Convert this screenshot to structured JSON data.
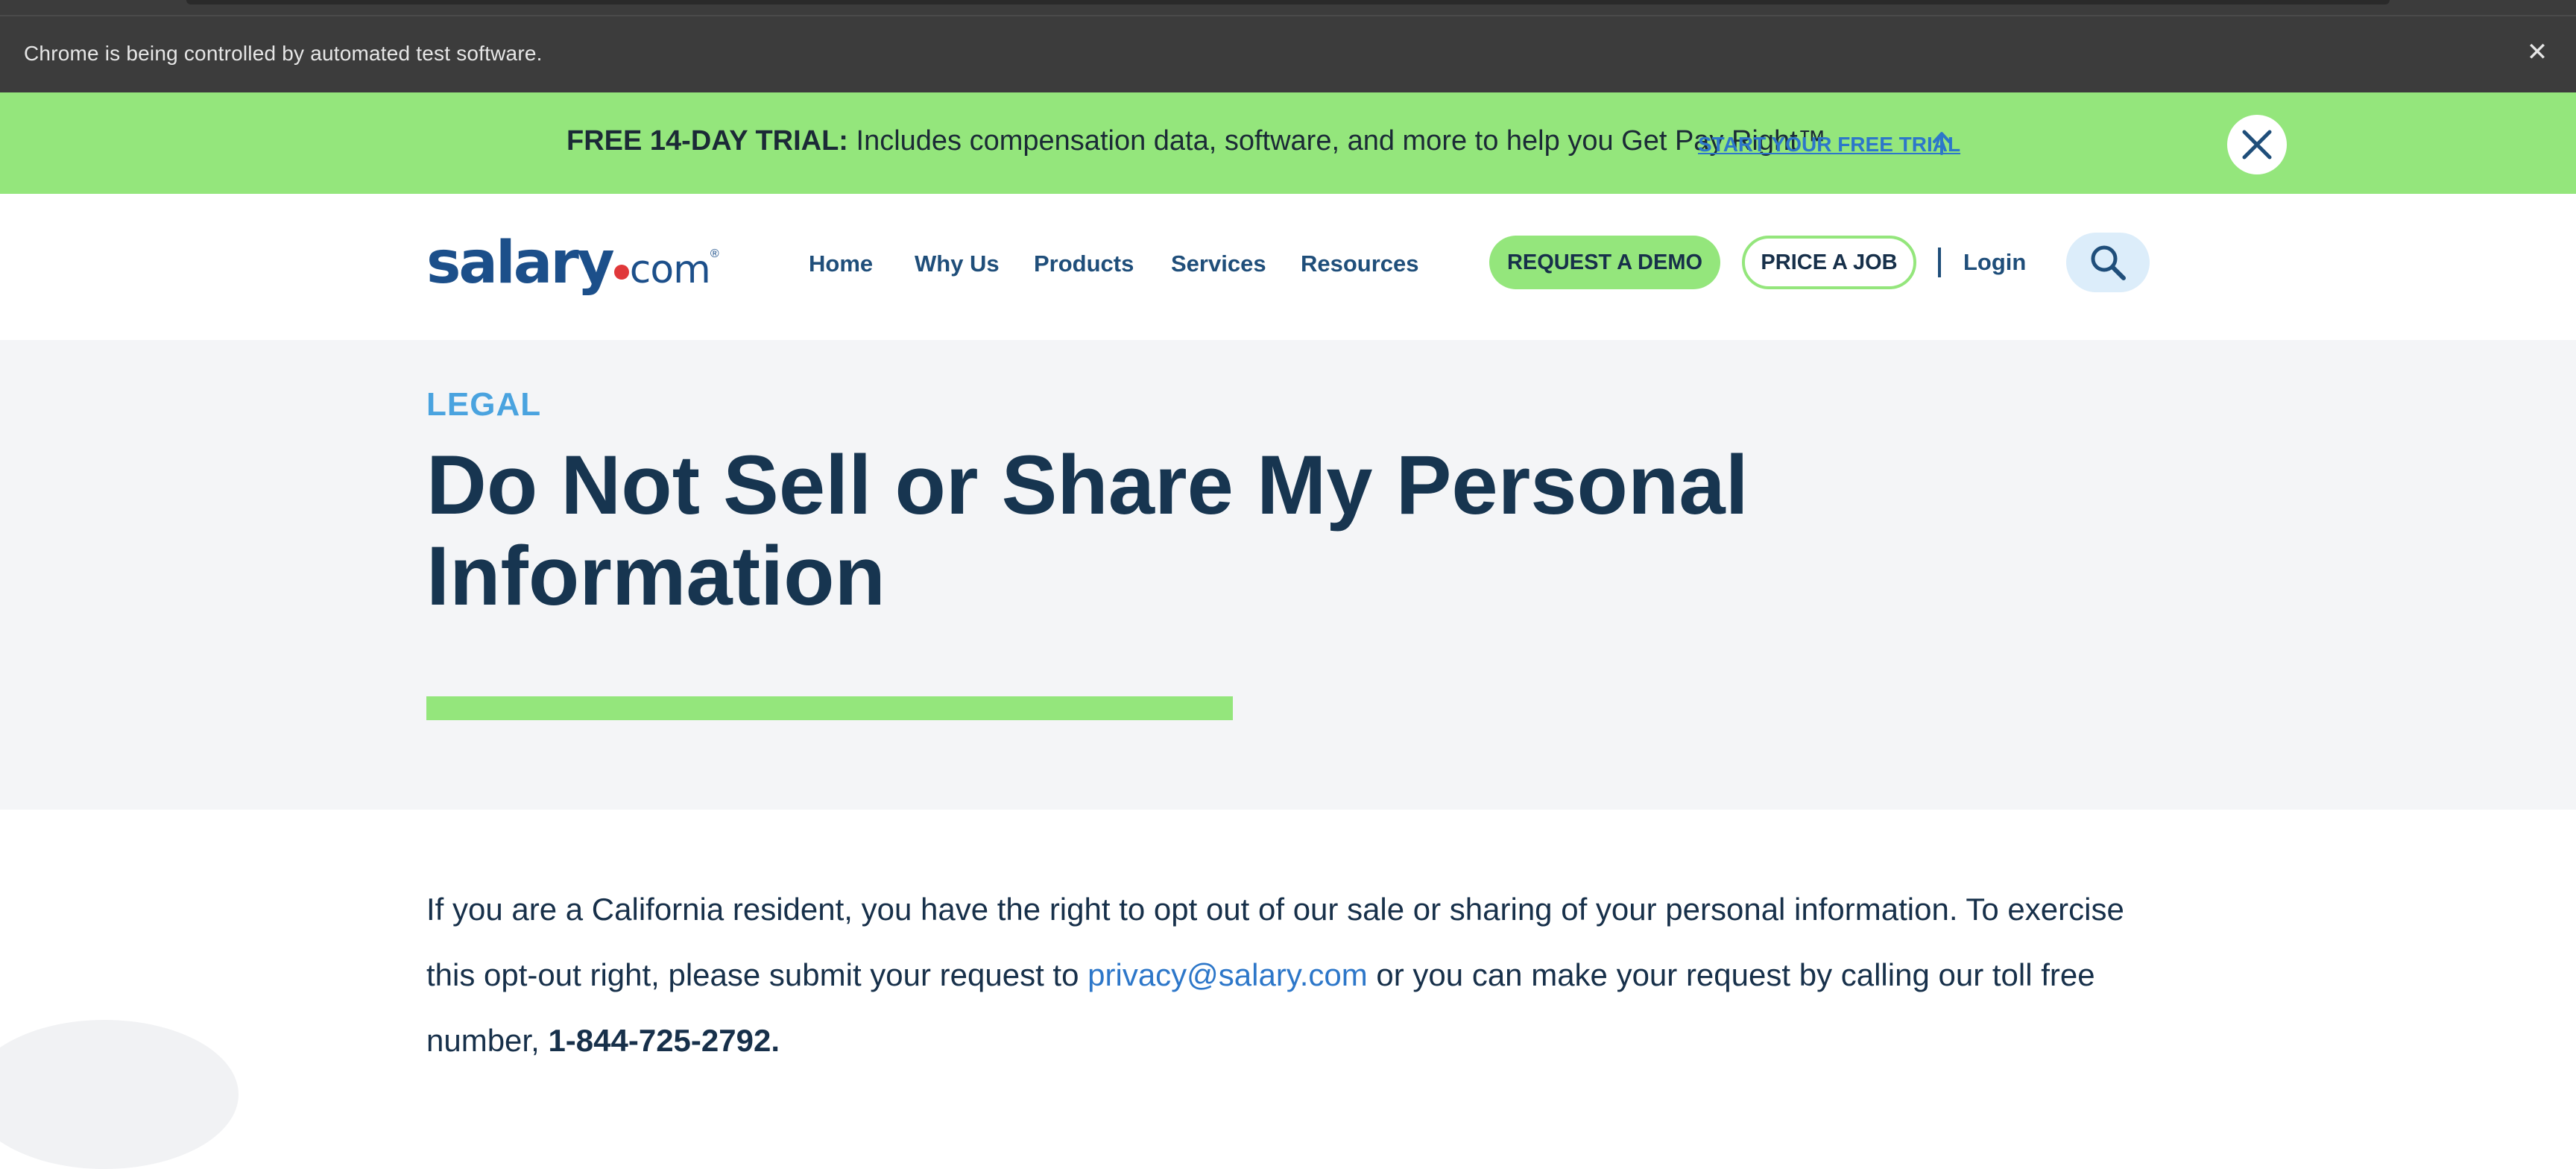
{
  "browser": {
    "automation_notice": "Chrome is being controlled by automated test software.",
    "close_glyph": "✕"
  },
  "promo": {
    "bold_label": "FREE 14-DAY TRIAL:",
    "text": " Includes compensation data, software, and more to help you Get Pay Right™",
    "cta_label": "START YOUR FREE TRIAL",
    "background": "#94e67c",
    "link_color": "#2d77c9"
  },
  "header": {
    "logo": {
      "word": "salary",
      "suffix": "com",
      "reg": "®"
    },
    "nav": [
      "Home",
      "Why Us",
      "Products",
      "Services",
      "Resources"
    ],
    "demo_label": "REQUEST A DEMO",
    "price_label": "PRICE A JOB",
    "login_label": "Login",
    "brand_color": "#1c4f8a",
    "accent_green": "#94e67c"
  },
  "hero": {
    "eyebrow": "LEGAL",
    "title": "Do Not Sell or Share My Personal Information",
    "title_color": "#173550",
    "eyebrow_color": "#4aa3df"
  },
  "content": {
    "intro": "If you are a California resident, you have the right to opt out of our sale or sharing of your personal information. To exercise this opt-out right, please submit your request to ",
    "email": "privacy@salary.com",
    "middle": " or you can make your request by calling our toll free number, ",
    "phone": "1-844-725-2792."
  },
  "icons": {
    "close": "close-icon",
    "arrow": "arrow-up-icon",
    "search": "search-icon"
  }
}
